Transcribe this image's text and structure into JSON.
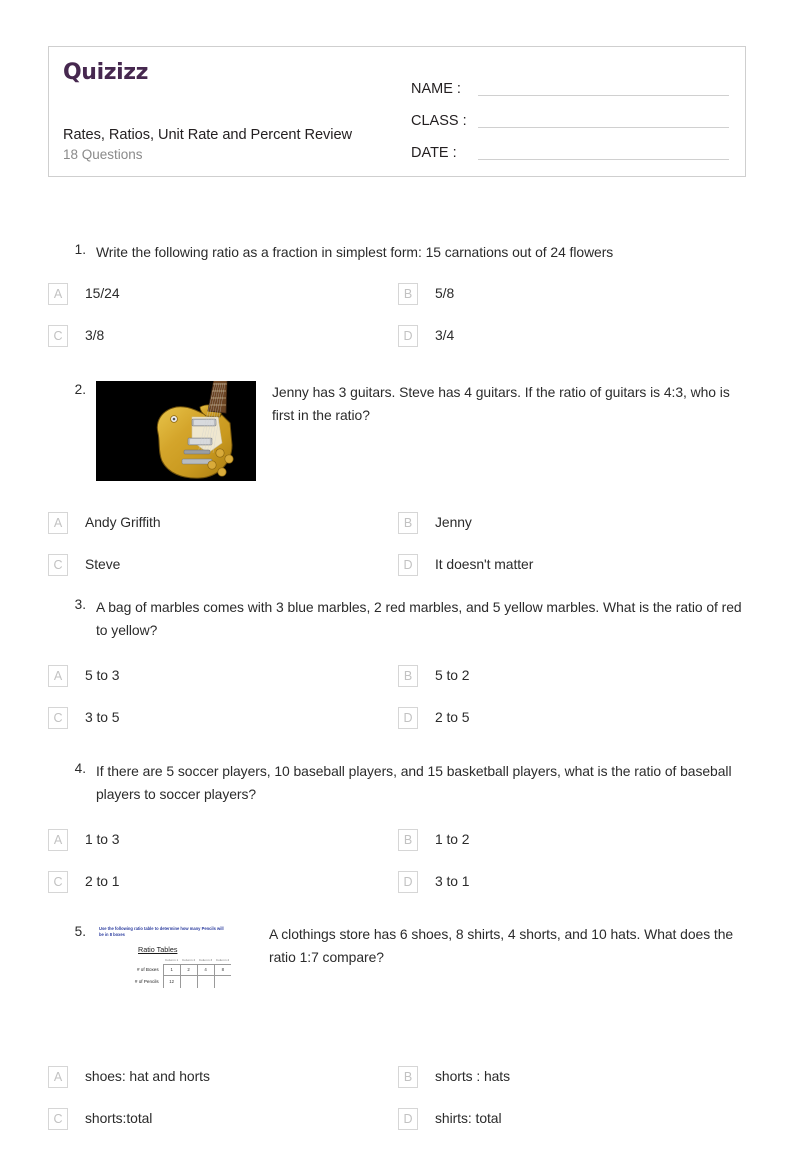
{
  "header": {
    "logo_text": "Quizizz",
    "logo_color": "#46284f",
    "quiz_title": "Rates, Ratios, Unit Rate and Percent Review",
    "question_count_label": "18 Questions",
    "fields": [
      {
        "label": "NAME :"
      },
      {
        "label": "CLASS :"
      },
      {
        "label": "DATE  :"
      }
    ]
  },
  "questions": [
    {
      "number": "1.",
      "text": "Write the following ratio as a fraction in simplest form: 15 carnations out of 24 flowers",
      "has_image": false,
      "options": [
        {
          "letter": "A",
          "text": "15/24"
        },
        {
          "letter": "B",
          "text": "5/8"
        },
        {
          "letter": "C",
          "text": "3/8"
        },
        {
          "letter": "D",
          "text": "3/4"
        }
      ]
    },
    {
      "number": "2.",
      "text": "Jenny has 3 guitars. Steve has 4 guitars. If the ratio of guitars is 4:3, who is first in the ratio?",
      "has_image": true,
      "image_name": "guitar-photo",
      "options": [
        {
          "letter": "A",
          "text": "Andy Griffith"
        },
        {
          "letter": "B",
          "text": "Jenny"
        },
        {
          "letter": "C",
          "text": "Steve"
        },
        {
          "letter": "D",
          "text": "It doesn't matter"
        }
      ]
    },
    {
      "number": "3.",
      "text": "A bag of marbles comes with 3 blue marbles, 2 red marbles, and 5 yellow marbles. What is the ratio of red to yellow?",
      "has_image": false,
      "options": [
        {
          "letter": "A",
          "text": "5 to 3"
        },
        {
          "letter": "B",
          "text": "5 to 2"
        },
        {
          "letter": "C",
          "text": "3 to 5"
        },
        {
          "letter": "D",
          "text": "2 to 5"
        }
      ]
    },
    {
      "number": "4.",
      "text": "If there are 5 soccer players, 10 baseball players, and 15 basketball players, what is the ratio of baseball players to soccer players?",
      "has_image": false,
      "options": [
        {
          "letter": "A",
          "text": "1 to 3"
        },
        {
          "letter": "B",
          "text": "1 to 2"
        },
        {
          "letter": "C",
          "text": "2 to 1"
        },
        {
          "letter": "D",
          "text": "3 to 1"
        }
      ]
    },
    {
      "number": "5.",
      "text": "A clothings store has 6 shoes, 8 shirts, 4 shorts, and 10 hats. What does the ratio 1:7 compare?",
      "has_image": true,
      "image_name": "ratio-table-graphic",
      "options": [
        {
          "letter": "A",
          "text": "shoes: hat and horts"
        },
        {
          "letter": "B",
          "text": "shorts : hats"
        },
        {
          "letter": "C",
          "text": "shorts:total"
        },
        {
          "letter": "D",
          "text": "shirts: total"
        }
      ]
    }
  ],
  "ratio_table_image": {
    "caption": "Use the following ratio table to determine how many Pencils will be in 8 boxes",
    "title": "Ratio Tables",
    "column_headers": [
      "Column 1",
      "Column 2",
      "Column 3",
      "Column 4"
    ],
    "rows": [
      {
        "label": "# of Boxes",
        "values": [
          "1",
          "2",
          "4",
          "8"
        ]
      },
      {
        "label": "# of Pencils",
        "values": [
          "12",
          "",
          "",
          ""
        ]
      }
    ],
    "caption_color": "#2a3b9e"
  }
}
